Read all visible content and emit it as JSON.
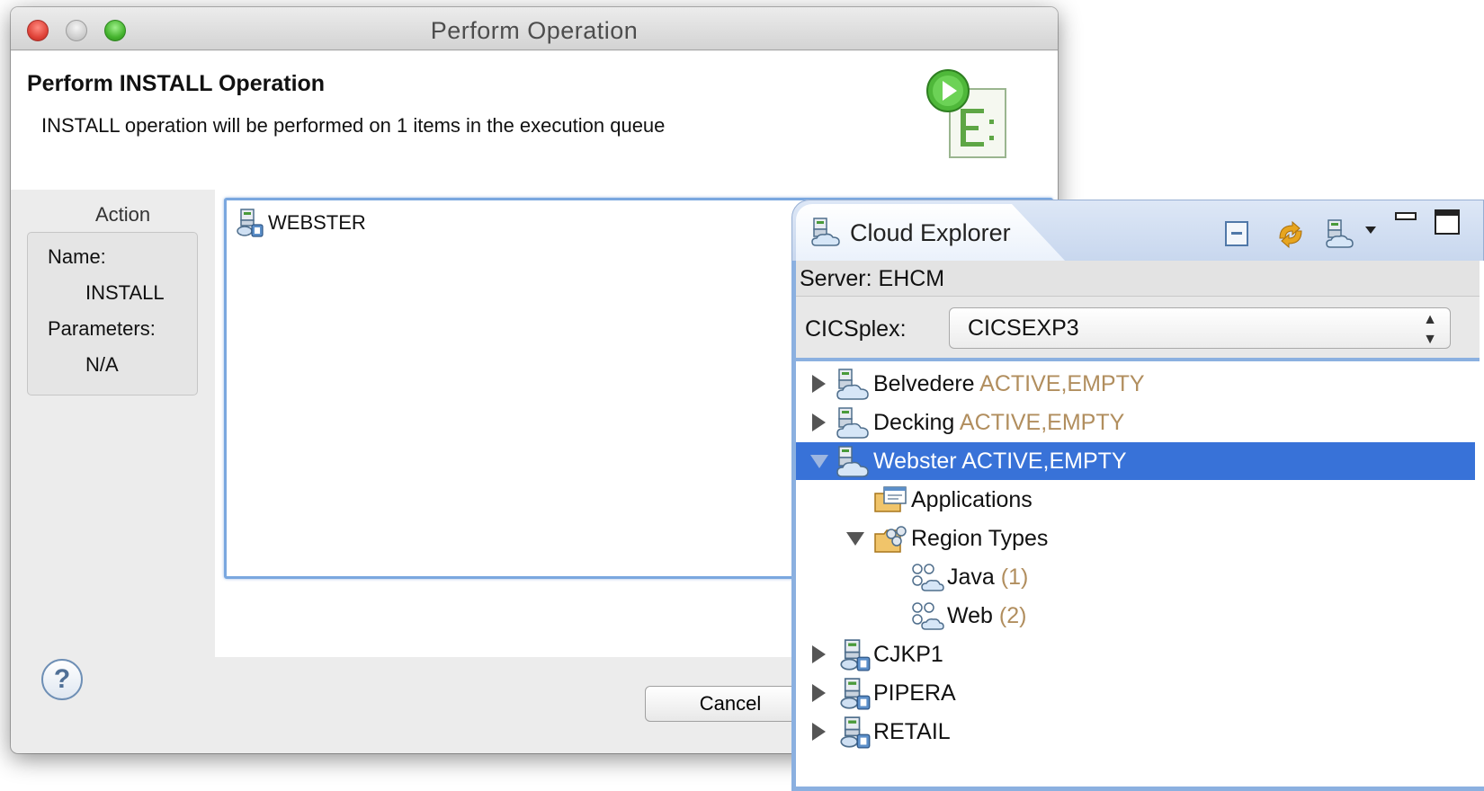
{
  "dialog": {
    "window_title": "Perform Operation",
    "header_title": "Perform INSTALL Operation",
    "header_description": "INSTALL operation will be performed on 1 items in the execution queue",
    "action": {
      "section_label": "Action",
      "name_label": "Name:",
      "name_value": "INSTALL",
      "parameters_label": "Parameters:",
      "parameters_value": "N/A"
    },
    "queue_items": [
      {
        "label": "WEBSTER",
        "icon": "platform-icon"
      }
    ],
    "help_glyph": "?",
    "cancel_label": "Cancel"
  },
  "explorer": {
    "tab_title": "Cloud Explorer",
    "server_label": "Server: EHCM",
    "cicsplex_label": "CICSplex:",
    "cicsplex_value": "CICSEXP3",
    "tree": [
      {
        "label": "Belvedere",
        "status": "ACTIVE,EMPTY",
        "icon": "platform-cloud-icon",
        "expanded": false,
        "selected": false,
        "level": 0
      },
      {
        "label": "Decking",
        "status": "ACTIVE,EMPTY",
        "icon": "platform-cloud-icon",
        "expanded": false,
        "selected": false,
        "level": 0
      },
      {
        "label": "Webster",
        "status": "ACTIVE,EMPTY",
        "icon": "platform-cloud-icon",
        "expanded": true,
        "selected": true,
        "level": 0
      },
      {
        "label": "Applications",
        "icon": "applications-folder-icon",
        "level": 1
      },
      {
        "label": "Region Types",
        "icon": "region-types-folder-icon",
        "expanded": true,
        "level": 1
      },
      {
        "label": "Java",
        "count": "(1)",
        "icon": "region-type-icon",
        "level": 2
      },
      {
        "label": "Web",
        "count": "(2)",
        "icon": "region-type-icon",
        "level": 2
      },
      {
        "label": "CJKP1",
        "icon": "platform-icon",
        "expanded": false,
        "level": 0
      },
      {
        "label": "PIPERA",
        "icon": "platform-icon",
        "expanded": false,
        "level": 0
      },
      {
        "label": "RETAIL",
        "icon": "platform-icon",
        "expanded": false,
        "level": 0
      }
    ]
  },
  "colors": {
    "selection": "#3872d8",
    "status_text": "#b18e5e",
    "focus_border": "#7aa7df"
  }
}
